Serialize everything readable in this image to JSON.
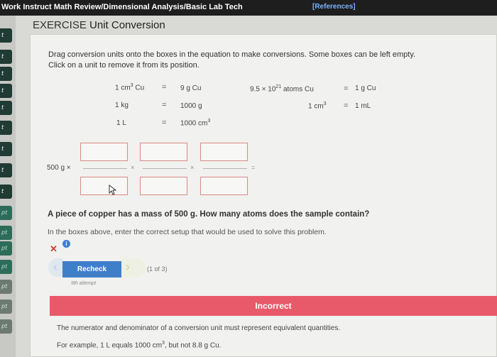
{
  "header": {
    "title": "Work Instruct Math Review/Dimensional Analysis/Basic Lab Tech",
    "references": "[References]"
  },
  "sidebar": {
    "tabs": [
      "t",
      "t",
      "t",
      "t",
      "t",
      "t",
      "t",
      "t",
      "t",
      "pt",
      "pt",
      "pt",
      "pt",
      "pt",
      "pt",
      "pt"
    ]
  },
  "exercise": {
    "label": "EXERCISE",
    "title": "Unit Conversion"
  },
  "instructions": {
    "line1": "Drag conversion units onto the boxes in the equation to make conversions. Some boxes can be left empty.",
    "line2": "Click on a unit to remove it from its position."
  },
  "units": {
    "row1_left_num": "1 cm",
    "row1_left_exp": "3",
    "row1_left_unit": " Cu",
    "row1_eq": "=",
    "row1_right": "9 g Cu",
    "row2_left": "1 kg",
    "row2_eq": "=",
    "row2_right": "1000 g",
    "row3_left": "1 L",
    "row3_eq": "=",
    "row3_right_num": "1000 cm",
    "row3_right_exp": "3",
    "col2_row1_base": "9.5 × 10",
    "col2_row1_exp": "21",
    "col2_row1_unit": " atoms Cu",
    "col2_row1_eq": "=",
    "col2_row1_right": "1 g Cu",
    "col2_row2_num": "1 cm",
    "col2_row2_exp": "3",
    "col2_row2_eq": "=",
    "col2_row2_right": "1 mL"
  },
  "equation": {
    "start": "500 g  ×",
    "times": "×",
    "equals": "="
  },
  "question": {
    "text": "A piece of copper has a mass of 500 g. How many atoms does the sample contain?",
    "subtext": "In the boxes above, enter the correct setup that would be used to solve this problem."
  },
  "controls": {
    "recheck": "Recheck",
    "counter": "(1 of 3)",
    "attempt": "9th attempt"
  },
  "feedback": {
    "status": "Incorrect",
    "line1": "The numerator and denominator of a conversion unit must represent equivalent quantities.",
    "line2_a": "For example, 1 L equals 1000 cm",
    "line2_exp": "3",
    "line2_b": ", but not 8.8 g Cu."
  },
  "colors": {
    "incorrect_bar": "#e85a6a",
    "recheck_button": "#3f7fc9",
    "dropbox_border": "#d88a84",
    "error_mark": "#d53a2f"
  }
}
